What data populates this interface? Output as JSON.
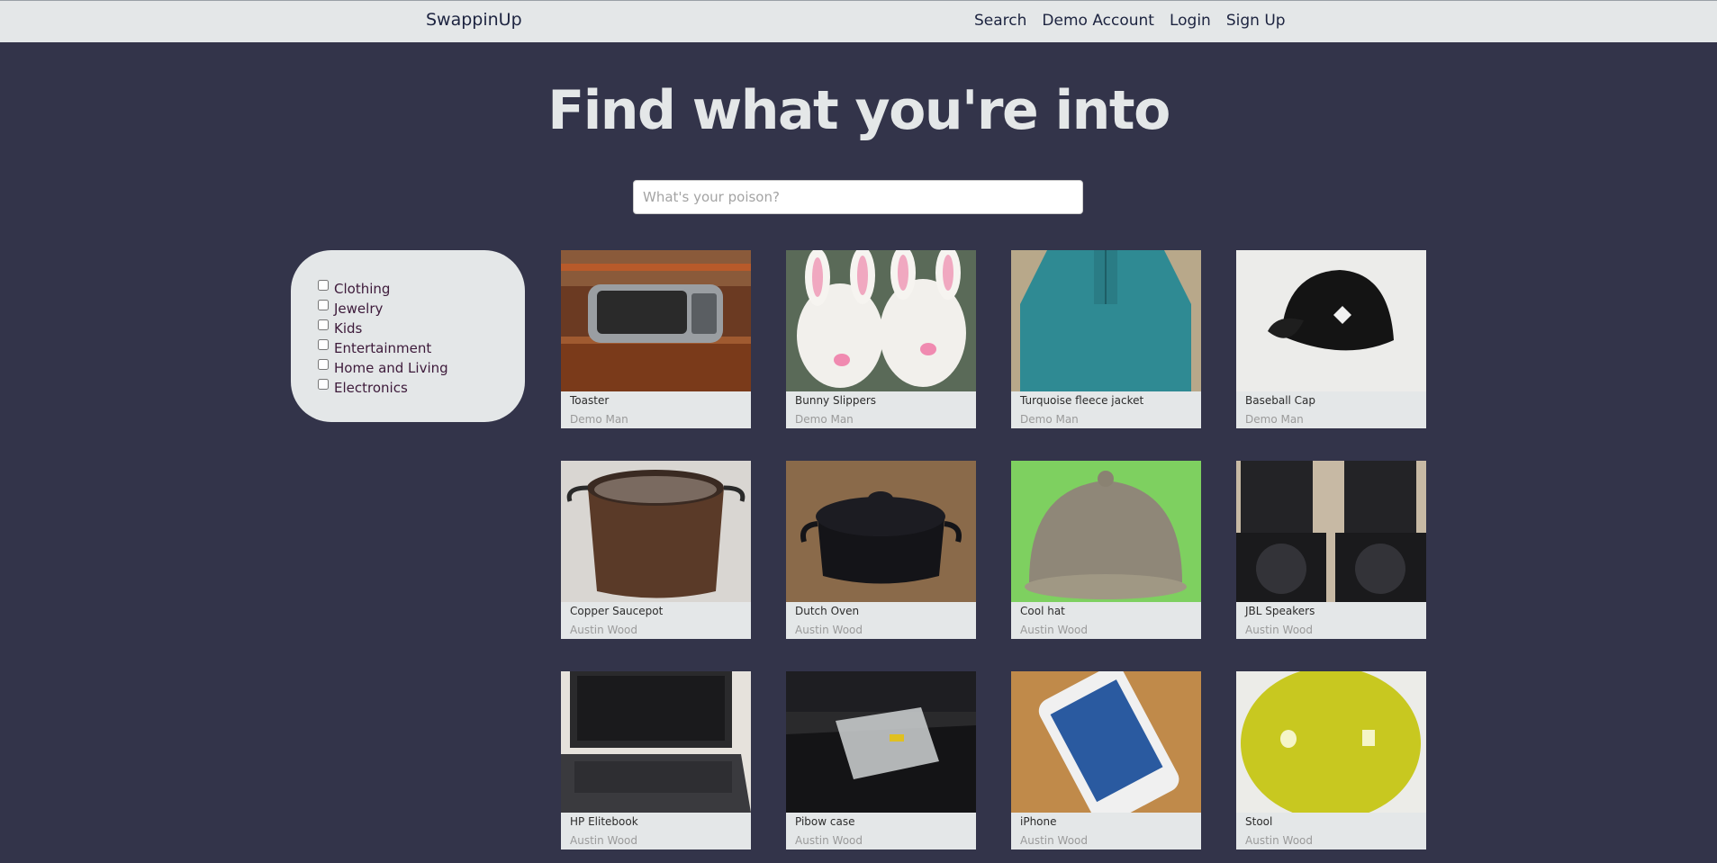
{
  "nav": {
    "brand": "SwappinUp",
    "links": [
      "Search",
      "Demo Account",
      "Login",
      "Sign Up"
    ]
  },
  "hero": {
    "title": "Find what you're into"
  },
  "search": {
    "placeholder": "What's your poison?",
    "value": ""
  },
  "filters": {
    "categories": [
      "Clothing",
      "Jewelry",
      "Kids",
      "Entertainment",
      "Home and Living",
      "Electronics"
    ]
  },
  "items": [
    {
      "title": "Toaster",
      "owner": "Demo Man",
      "image": "toaster"
    },
    {
      "title": "Bunny Slippers",
      "owner": "Demo Man",
      "image": "bunny-slippers"
    },
    {
      "title": "Turquoise fleece jacket",
      "owner": "Demo Man",
      "image": "fleece-jacket"
    },
    {
      "title": "Baseball Cap",
      "owner": "Demo Man",
      "image": "baseball-cap"
    },
    {
      "title": "Copper Saucepot",
      "owner": "Austin Wood",
      "image": "saucepot"
    },
    {
      "title": "Dutch Oven",
      "owner": "Austin Wood",
      "image": "dutch-oven"
    },
    {
      "title": "Cool hat",
      "owner": "Austin Wood",
      "image": "pith-helmet"
    },
    {
      "title": "JBL Speakers",
      "owner": "Austin Wood",
      "image": "speakers"
    },
    {
      "title": "HP Elitebook",
      "owner": "Austin Wood",
      "image": "laptop"
    },
    {
      "title": "Pibow case",
      "owner": "Austin Wood",
      "image": "pi-case"
    },
    {
      "title": "iPhone",
      "owner": "Austin Wood",
      "image": "iphone"
    },
    {
      "title": "Stool",
      "owner": "Austin Wood",
      "image": "stool"
    }
  ],
  "colors": {
    "background": "#33344a",
    "panel": "#e4e7e8",
    "text_dark": "#1d2440",
    "filter_label": "#3d1a3a"
  }
}
